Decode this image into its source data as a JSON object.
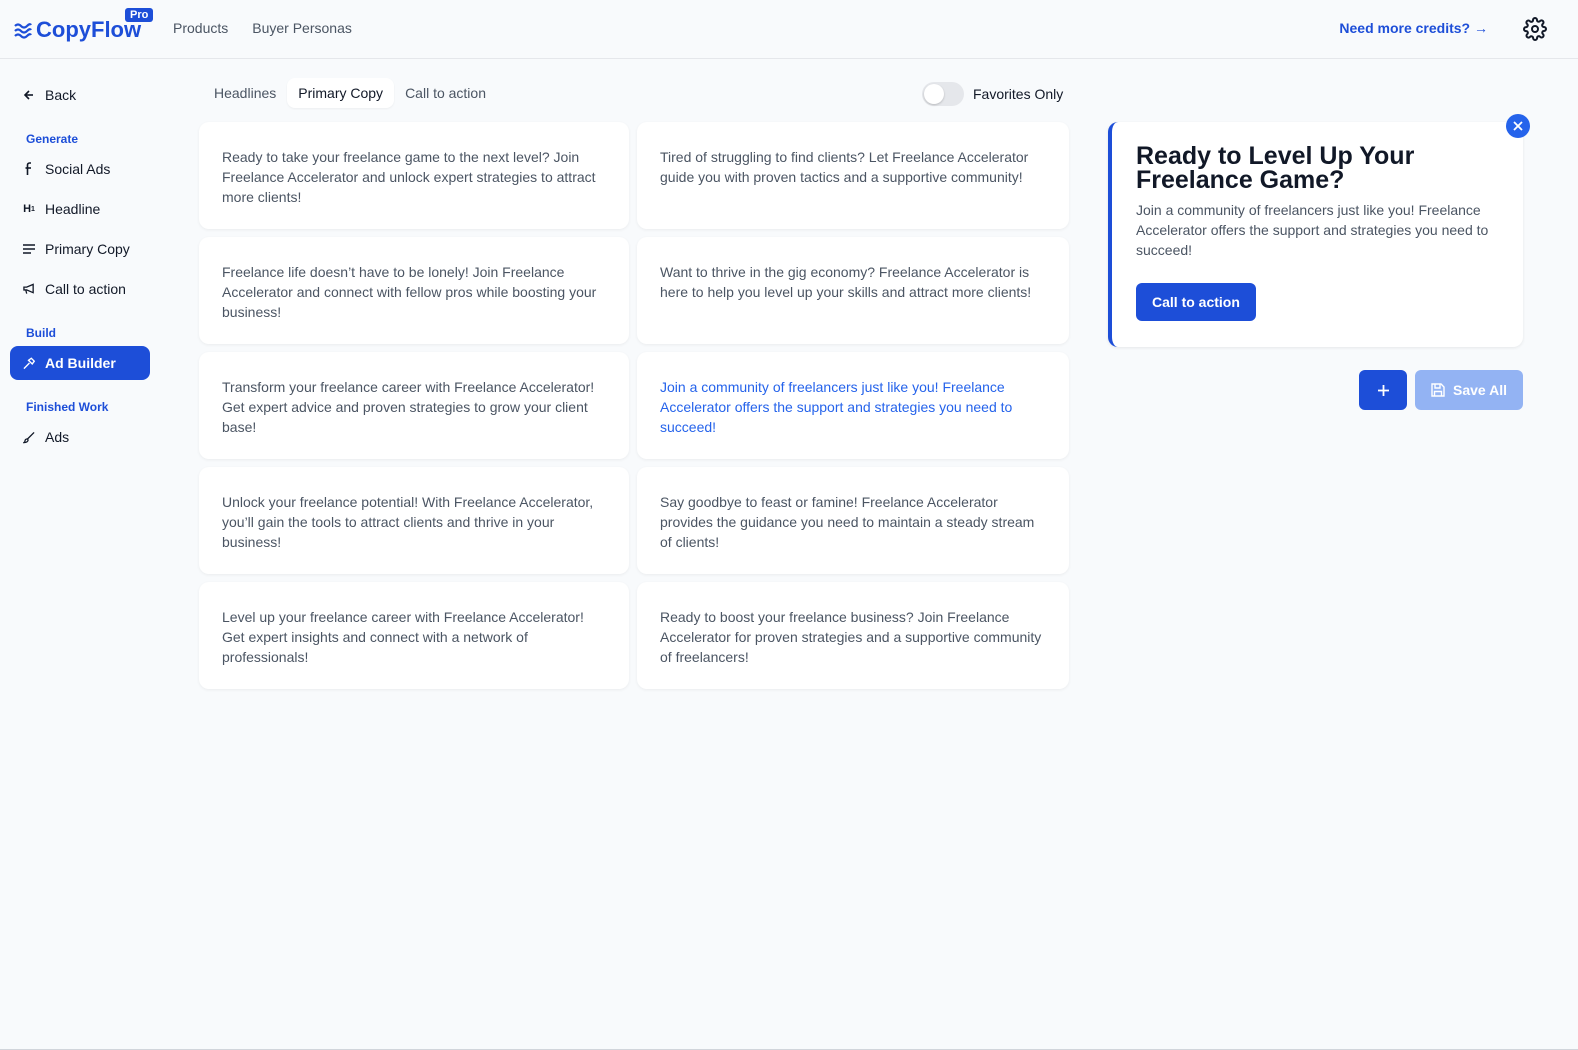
{
  "header": {
    "logo_text": "CopyFlow",
    "pro_badge": "Pro",
    "nav": [
      "Products",
      "Buyer Personas"
    ],
    "credits_link": "Need more credits? →"
  },
  "sidebar": {
    "back": "Back",
    "sections": {
      "generate": "Generate",
      "build": "Build",
      "finished": "Finished Work"
    },
    "generate_items": [
      "Social Ads",
      "Headline",
      "Primary Copy",
      "Call to action"
    ],
    "build_items": [
      "Ad Builder"
    ],
    "finished_items": [
      "Ads"
    ]
  },
  "tabs": [
    "Headlines",
    "Primary Copy",
    "Call to action"
  ],
  "active_tab": "Primary Copy",
  "favorites_toggle": {
    "label": "Favorites Only",
    "on": false
  },
  "cards": [
    "Ready to take your freelance game to the next level? Join Freelance Accelerator and unlock expert strategies to attract more clients!",
    "Tired of struggling to find clients? Let Freelance Accelerator guide you with proven tactics and a supportive community!",
    "Freelance life doesn’t have to be lonely! Join Freelance Accelerator and connect with fellow pros while boosting your business!",
    "Want to thrive in the gig economy? Freelance Accelerator is here to help you level up your skills and attract more clients!",
    "Transform your freelance career with Freelance Accelerator! Get expert advice and proven strategies to grow your client base!",
    "Join a community of freelancers just like you! Freelance Accelerator offers the support and strategies you need to succeed!",
    "Unlock your freelance potential! With Freelance Accelerator, you’ll gain the tools to attract clients and thrive in your business!",
    "Say goodbye to feast or famine! Freelance Accelerator provides the guidance you need to maintain a steady stream of clients!",
    "Level up your freelance career with Freelance Accelerator! Get expert insights and connect with a network of professionals!",
    "Ready to boost your freelance business? Join Freelance Accelerator for proven strategies and a supportive community of freelancers!"
  ],
  "preview": {
    "headline": "Ready to Level Up Your Freelance Game?",
    "body": "Join a community of freelancers just like you! Freelance Accelerator offers the support and strategies you need to succeed!",
    "cta": "Call to action"
  },
  "actions": {
    "save_all": "Save All",
    "add": "+"
  },
  "colors": {
    "accent": "#1d4ed8",
    "selected_text": "#2563eb",
    "save_disabled": "#93b3f3"
  }
}
